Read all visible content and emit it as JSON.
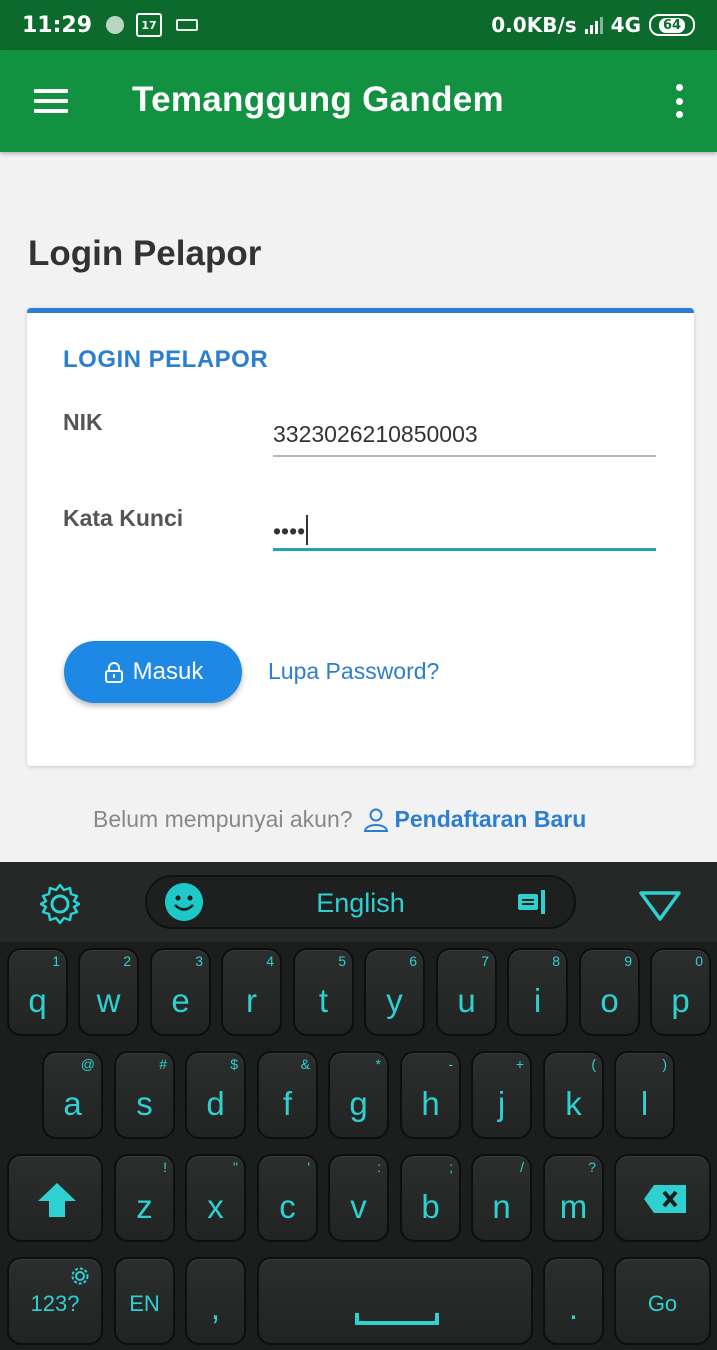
{
  "status_bar": {
    "time": "11:29",
    "calendar_day": "17",
    "network_speed": "0.0KB/s",
    "network_type": "4G",
    "battery": "64"
  },
  "app_bar": {
    "title": "Temanggung Gandem",
    "menu_icon": "hamburger-menu-icon",
    "overflow_icon": "more-vert-icon"
  },
  "page": {
    "title": "Login Pelapor"
  },
  "login_card": {
    "title": "LOGIN PELAPOR",
    "nik_label": "NIK",
    "nik_value": "3323026210850003",
    "password_label": "Kata Kunci",
    "password_value": "••••",
    "submit_label": "Masuk",
    "forgot_label": "Lupa Password?"
  },
  "register": {
    "prompt": "Belum mempunyai akun?",
    "link_label": "Pendaftaran Baru"
  },
  "keyboard": {
    "language": "English",
    "row1": [
      {
        "ch": "q",
        "sub": "1"
      },
      {
        "ch": "w",
        "sub": "2"
      },
      {
        "ch": "e",
        "sub": "3"
      },
      {
        "ch": "r",
        "sub": "4"
      },
      {
        "ch": "t",
        "sub": "5"
      },
      {
        "ch": "y",
        "sub": "6"
      },
      {
        "ch": "u",
        "sub": "7"
      },
      {
        "ch": "i",
        "sub": "8"
      },
      {
        "ch": "o",
        "sub": "9"
      },
      {
        "ch": "p",
        "sub": "0"
      }
    ],
    "row2": [
      {
        "ch": "a",
        "sub": "@"
      },
      {
        "ch": "s",
        "sub": "#"
      },
      {
        "ch": "d",
        "sub": "$"
      },
      {
        "ch": "f",
        "sub": "&"
      },
      {
        "ch": "g",
        "sub": "*"
      },
      {
        "ch": "h",
        "sub": "-"
      },
      {
        "ch": "j",
        "sub": "+"
      },
      {
        "ch": "k",
        "sub": "("
      },
      {
        "ch": "l",
        "sub": ")"
      }
    ],
    "row3": [
      {
        "ch": "z",
        "sub": "!"
      },
      {
        "ch": "x",
        "sub": "\""
      },
      {
        "ch": "c",
        "sub": "'"
      },
      {
        "ch": "v",
        "sub": ":"
      },
      {
        "ch": "b",
        "sub": ";"
      },
      {
        "ch": "n",
        "sub": "/"
      },
      {
        "ch": "m",
        "sub": "?"
      }
    ],
    "symbols_label": "123?",
    "lang_key_label": "EN",
    "comma_label": ",",
    "period_label": ".",
    "go_label": "Go",
    "accent_color": "#2fd0d0"
  },
  "colors": {
    "status_bar": "#0b6a2c",
    "app_bar": "#129240",
    "primary_blue": "#2c7fd0",
    "button_blue": "#1e88e5",
    "input_focus": "#20a4b4"
  }
}
